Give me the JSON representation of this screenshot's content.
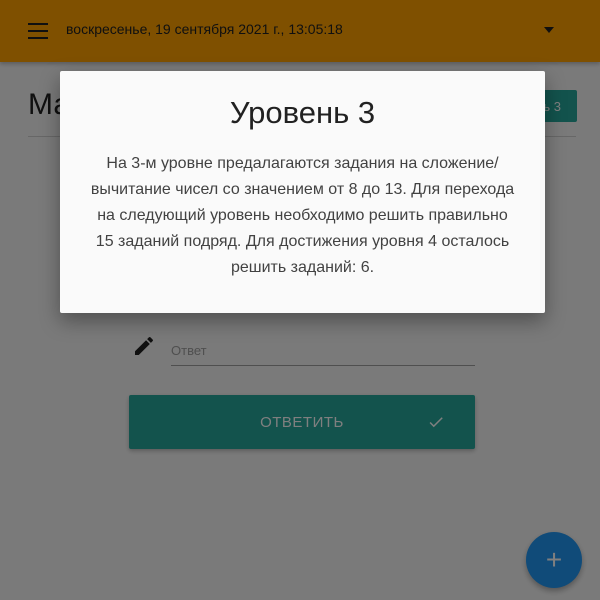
{
  "header": {
    "datetime": "воскресенье, 19 сентября 2021 г., 13:05:18",
    "background": "#ffa000"
  },
  "main": {
    "title_visible": "Ма",
    "level_button_visible": "ь 3",
    "answer_placeholder": "Ответ",
    "submit_label": "ОТВЕТИТЬ",
    "accent": "#26a69a"
  },
  "fab": {
    "icon": "plus-icon",
    "symbol": "+",
    "color": "#2196f3"
  },
  "modal": {
    "title": "Уровень 3",
    "body": "На 3-м уровне предалагаются задания на сложение/вычитание чисел со значением от 8 до 13. Для перехода на следующий уровень необходимо решить правильно 15 заданий подряд. Для достижения уровня 4 осталось решить заданий: 6."
  }
}
